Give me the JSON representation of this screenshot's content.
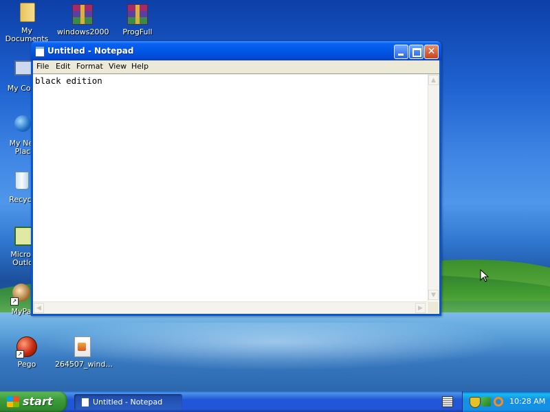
{
  "desktop": {
    "icons": [
      {
        "label": "My Documents",
        "icon": "folder-icon"
      },
      {
        "label": "windows2000",
        "icon": "rar-archive-icon"
      },
      {
        "label": "ProgFull",
        "icon": "rar-archive-icon"
      },
      {
        "label": "My Com",
        "icon": "computer-icon"
      },
      {
        "label": "My Net\nPlac",
        "icon": "network-places-icon"
      },
      {
        "label": "Recycl",
        "icon": "recycle-bin-icon"
      },
      {
        "label": "Micros\nOutlo",
        "icon": "outlook-icon"
      },
      {
        "label": "MyPa",
        "icon": "mypal-icon"
      },
      {
        "label": "Pego",
        "icon": "pego-icon"
      },
      {
        "label": "264507_wind...",
        "icon": "file-icon"
      }
    ]
  },
  "notepad": {
    "title": "Untitled - Notepad",
    "menu": [
      "File",
      "Edit",
      "Format",
      "View",
      "Help"
    ],
    "content": "black edition",
    "buttons": {
      "minimize": "minimize-icon",
      "maximize": "maximize-icon",
      "close": "close-icon"
    }
  },
  "taskbar": {
    "start_label": "start",
    "tasks": [
      {
        "label": "Untitled - Notepad"
      }
    ],
    "clock": "10:28 AM",
    "colors": {
      "start": "#3c9d3b",
      "bar": "#2157d7",
      "tray": "#1390e6"
    }
  }
}
